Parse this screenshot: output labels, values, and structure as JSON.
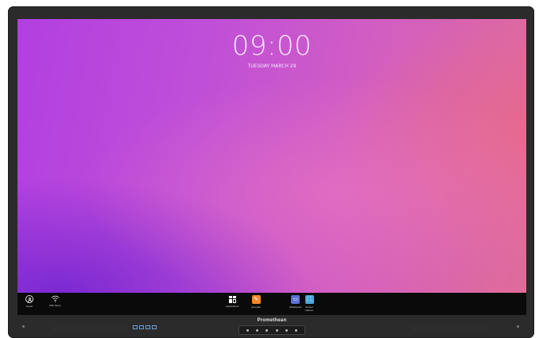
{
  "device": {
    "brand": "Promethean"
  },
  "lock_screen": {
    "time": "09:00",
    "date": "TUESDAY MARCH 29"
  },
  "taskbar": {
    "left": [
      {
        "label": "Guest",
        "icon": "user-icon"
      },
      {
        "label": "WiFi Name",
        "icon": "wifi-icon"
      }
    ],
    "center": [
      {
        "label": "Applications",
        "icon": "apps-grid-icon"
      },
      {
        "label": "Annotate",
        "icon": "annotate-icon",
        "color": "#f08a24"
      },
      {
        "label": "Whiteboard",
        "icon": "whiteboard-icon",
        "color": "#5a6fd0"
      },
      {
        "label": "Screen Capture",
        "icon": "screen-capture-icon",
        "color": "#4aa8d8"
      }
    ]
  },
  "colors": {
    "screen_gradient": [
      "#b23fe0",
      "#d25ec2",
      "#e06c98"
    ],
    "bezel": "#2b2b2b",
    "taskbar": "#0a0a0a"
  }
}
